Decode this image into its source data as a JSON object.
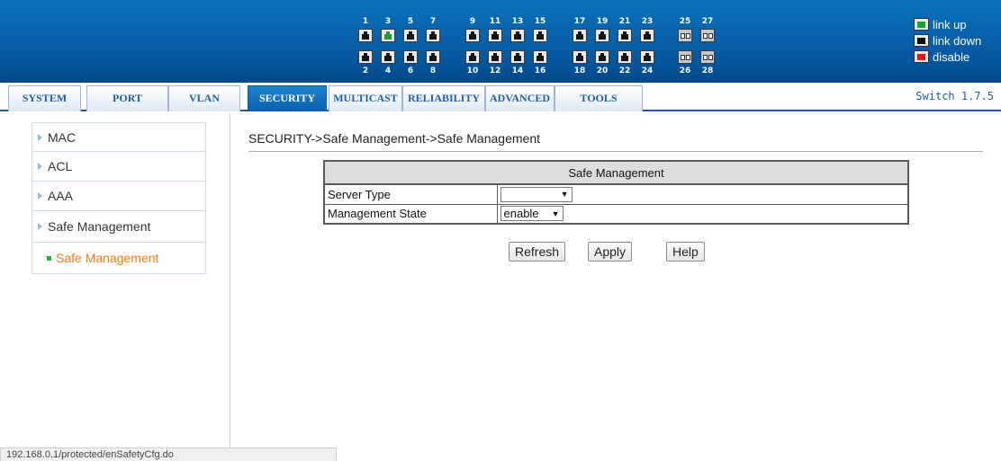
{
  "ports": {
    "columns": [
      {
        "top": "1",
        "bottom": "2",
        "top_link": false
      },
      {
        "top": "3",
        "bottom": "4",
        "top_link": true
      },
      {
        "top": "5",
        "bottom": "6",
        "top_link": false
      },
      {
        "top": "7",
        "bottom": "8",
        "top_link": false
      },
      {
        "top": "9",
        "bottom": "10",
        "top_link": false
      },
      {
        "top": "11",
        "bottom": "12",
        "top_link": false
      },
      {
        "top": "13",
        "bottom": "14",
        "top_link": false
      },
      {
        "top": "15",
        "bottom": "16",
        "top_link": false
      },
      {
        "top": "17",
        "bottom": "18",
        "top_link": false
      },
      {
        "top": "19",
        "bottom": "20",
        "top_link": false
      },
      {
        "top": "21",
        "bottom": "22",
        "top_link": false
      },
      {
        "top": "23",
        "bottom": "24",
        "top_link": false
      },
      {
        "top": "25",
        "bottom": "26",
        "top_link": false,
        "fiber": true
      },
      {
        "top": "27",
        "bottom": "28",
        "top_link": false,
        "fiber": true
      }
    ]
  },
  "legend": {
    "link_up": "link up",
    "link_down": "link down",
    "disable": "disable",
    "colors": {
      "up": "#1ea12c",
      "down": "#111111",
      "disable": "#e01a1a"
    }
  },
  "nav": {
    "tabs": [
      "SYSTEM",
      "PORT",
      "VLAN",
      "SECURITY",
      "MULTICAST",
      "RELIABILITY",
      "ADVANCED",
      "TOOLS"
    ],
    "active": "SECURITY",
    "version": "Switch 1.7.5"
  },
  "sidebar": {
    "items": [
      "MAC",
      "ACL",
      "AAA",
      "Safe Management"
    ],
    "sub_item": "Safe Management"
  },
  "main": {
    "breadcrumb": "SECURITY->Safe Management->Safe Management",
    "table_title": "Safe Management",
    "rows": [
      {
        "label": "Server Type",
        "value": ""
      },
      {
        "label": "Management State",
        "value": "enable"
      }
    ],
    "buttons": {
      "refresh": "Refresh",
      "apply": "Apply",
      "help": "Help"
    }
  },
  "status_bar": {
    "url": "192.168.0.1/protected/enSafetyCfg.do"
  },
  "colors": {
    "header_blue": "#0458a0",
    "active_tab": "#0760b1",
    "sub_item_orange": "#f07a16"
  }
}
